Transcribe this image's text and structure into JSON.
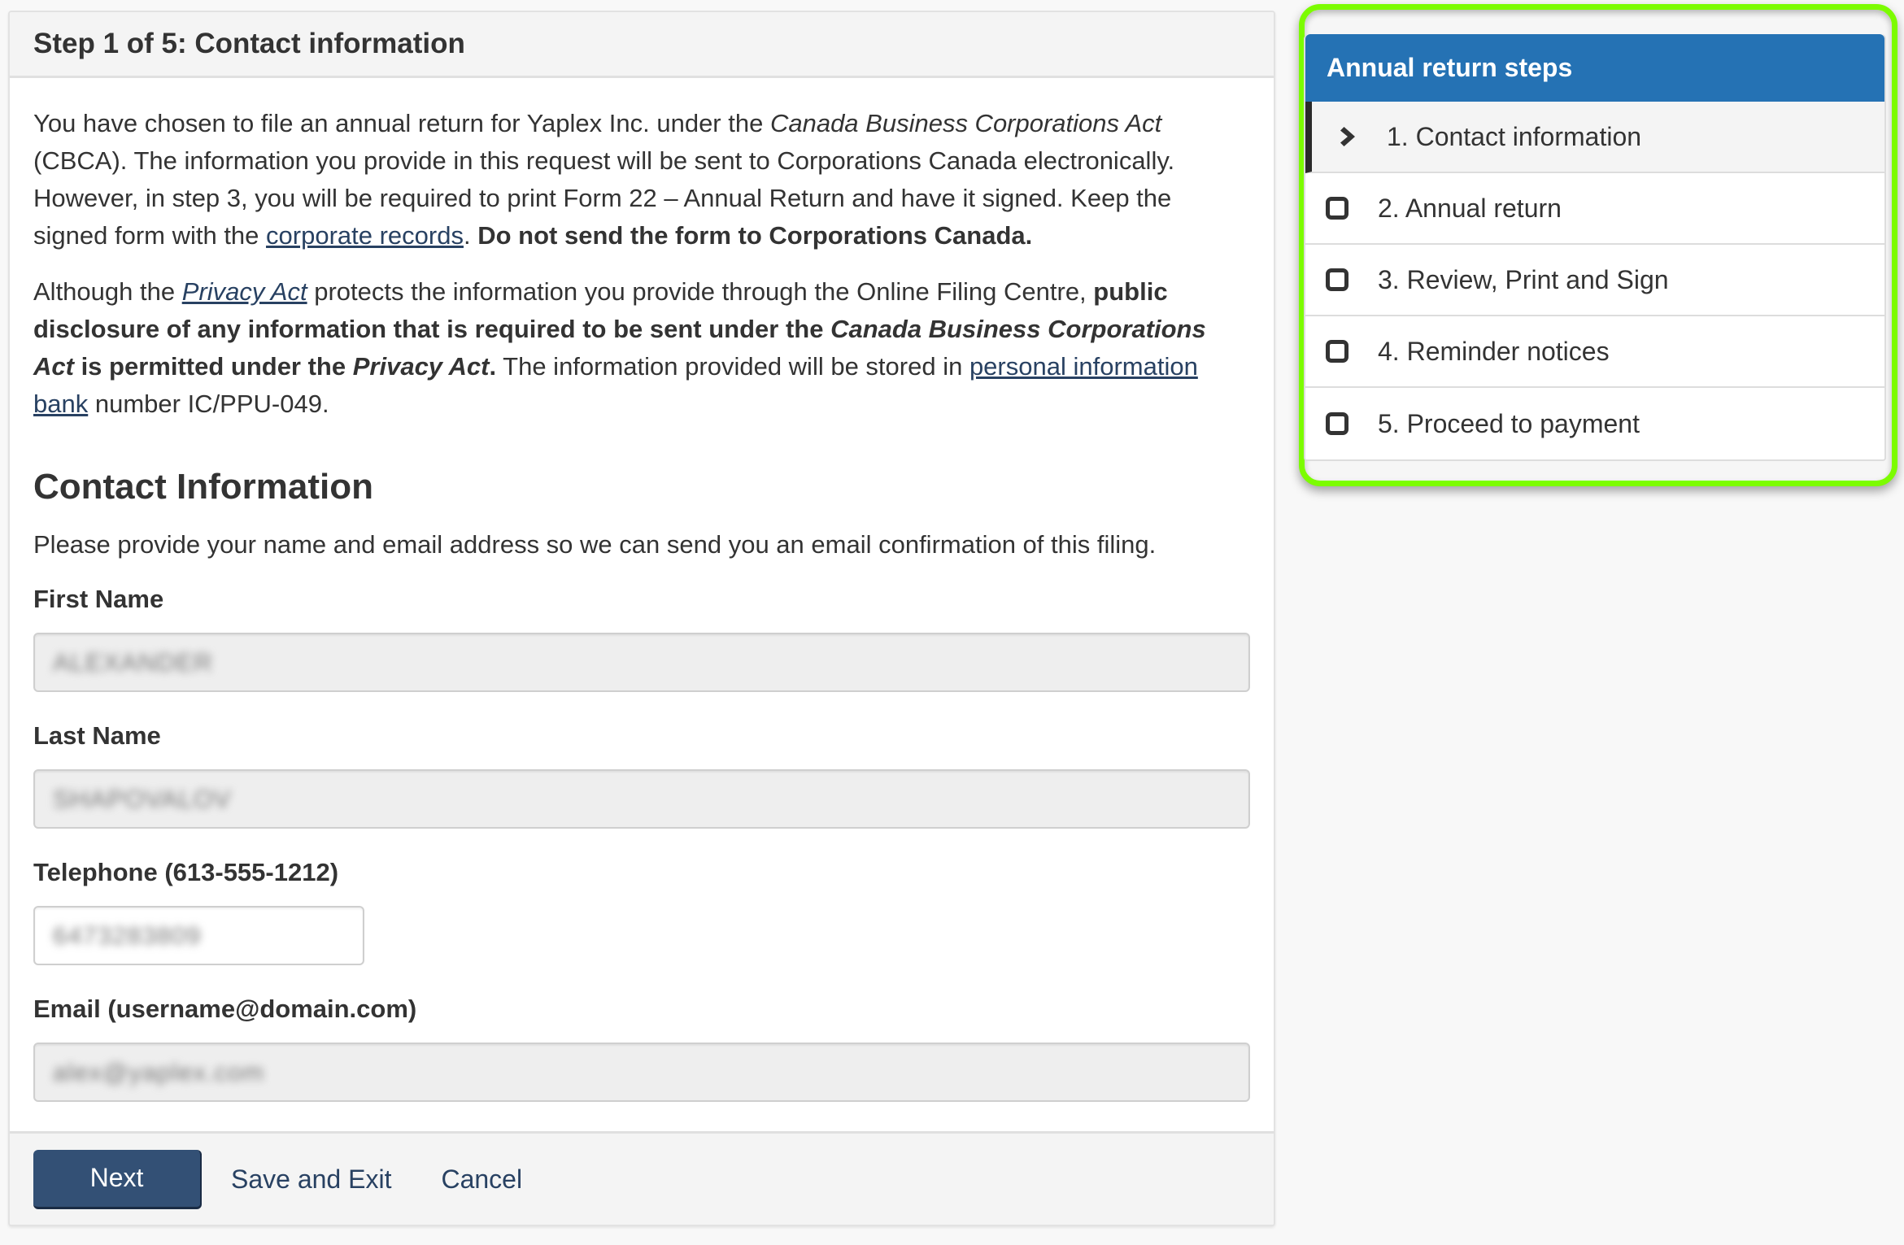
{
  "main": {
    "heading": "Step 1 of 5: Contact information",
    "intro_p1": {
      "t1": "You have chosen to file an annual return for Yaplex Inc. under the ",
      "act_name": "Canada Business Corporations Act",
      "t2": " (CBCA). The information you provide in this request will be sent to Corporations Canada electronically. However, in step 3, you will be required to print Form 22 – Annual Return and have it signed. Keep the signed form with the ",
      "link_corporate_records": "corporate records",
      "t3": ". ",
      "bold_warning": "Do not send the form to Corporations Canada."
    },
    "intro_p2": {
      "t1": "Although the ",
      "link_privacy_act": "Privacy Act",
      "t2": " protects the information you provide through the Online Filing Centre, ",
      "b1": "public disclosure of any information that is required to be sent under the ",
      "b_act": "Canada Business Corporations Act",
      "b2": " is permitted under the ",
      "b_privacy": "Privacy Act",
      "b3": ".",
      "t3": " The information provided will be stored in ",
      "link_pib": "personal information bank",
      "t4": " number IC/PPU-049."
    },
    "section_title": "Contact Information",
    "section_desc": "Please provide your name and email address so we can send you an email confirmation of this filing.",
    "fields": {
      "first_name": {
        "label": "First Name",
        "value": "ALEXANDER"
      },
      "last_name": {
        "label": "Last Name",
        "value": "SHAPOVALOV"
      },
      "telephone": {
        "label": "Telephone (613-555-1212)",
        "value": "6473283809"
      },
      "email": {
        "label": "Email (username@domain.com)",
        "value": "alex@yaplex.com"
      }
    },
    "footer": {
      "next_label": "Next",
      "save_exit_label": "Save and Exit",
      "cancel_label": "Cancel"
    }
  },
  "steps": {
    "title": "Annual return steps",
    "items": [
      {
        "label": "1. Contact information",
        "state": "current",
        "icon": "chevron-right-icon"
      },
      {
        "label": "2. Annual return",
        "state": "pending",
        "icon": "empty-box-icon"
      },
      {
        "label": "3. Review, Print and Sign",
        "state": "pending",
        "icon": "empty-box-icon"
      },
      {
        "label": "4. Reminder notices",
        "state": "pending",
        "icon": "empty-box-icon"
      },
      {
        "label": "5. Proceed to payment",
        "state": "pending",
        "icon": "empty-box-icon"
      }
    ]
  },
  "colors": {
    "primary_button": "#335075",
    "steps_header": "#2572b4",
    "link": "#284162",
    "highlight": "#7cfc00"
  }
}
